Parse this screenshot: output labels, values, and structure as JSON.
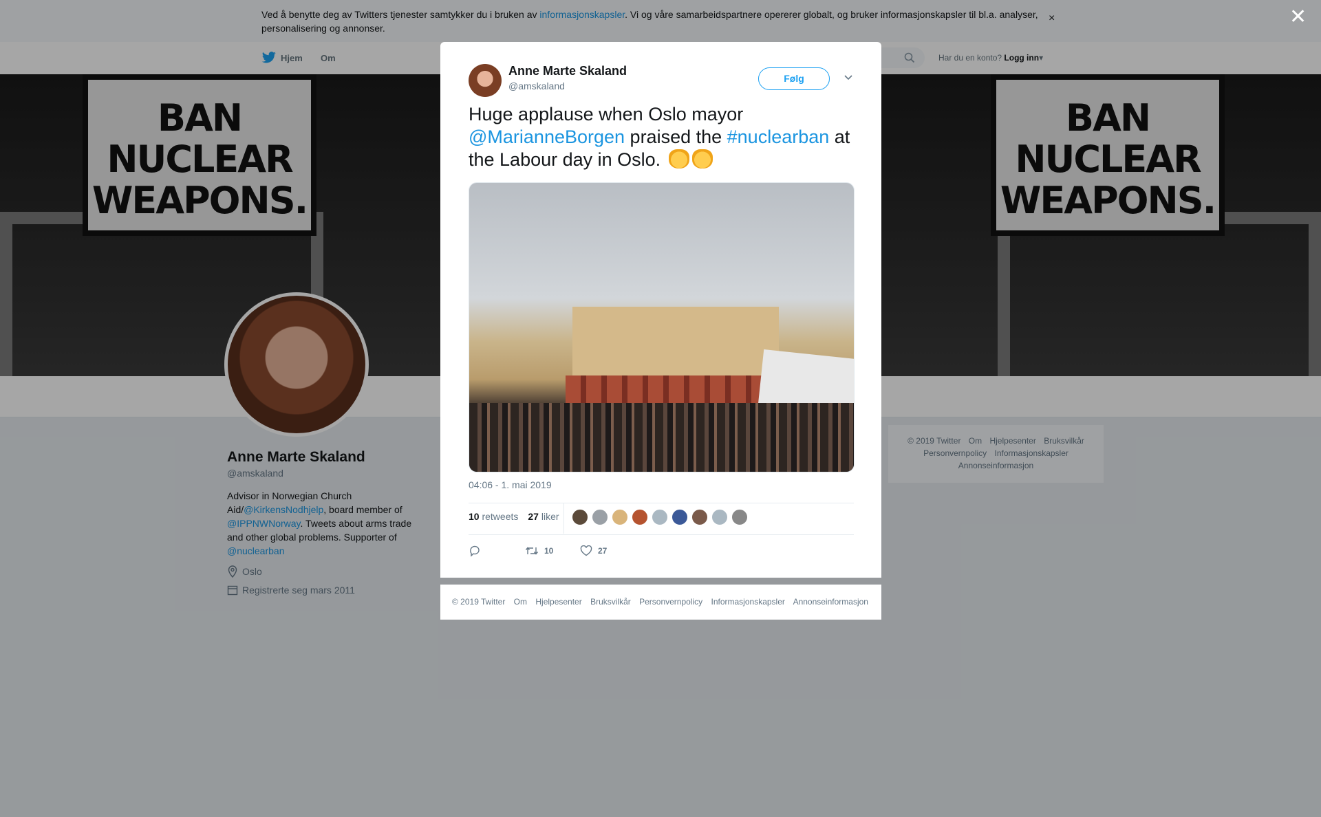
{
  "cookie": {
    "text_before": "Ved å benytte deg av Twitters tjenester samtykker du i bruken av ",
    "link": "informasjonskapsler",
    "text_after": ". Vi og våre samarbeidspartnere opererer globalt, og bruker informasjonskapsler til bl.a. analyser, personalisering og annonser.",
    "close": "×"
  },
  "nav": {
    "home": "Hjem",
    "about": "Om",
    "login_prompt": "Har du en konto?",
    "login": "Logg inn"
  },
  "banner": {
    "sign_line1": "BAN",
    "sign_line2": "NUCLEAR",
    "sign_line3": "WEAPONS."
  },
  "profile": {
    "name": "Anne Marte Skaland",
    "handle": "@amskaland",
    "bio_1": "Advisor in Norwegian Church Aid/",
    "bio_link1": "@KirkensNodhjelp",
    "bio_2": ", board member of ",
    "bio_link2": "@IPPNWNorway",
    "bio_3": ". Tweets about arms trade and other global problems. Supporter of ",
    "bio_link3": "@nuclearban",
    "location": "Oslo",
    "joined": "Registrerte seg mars 2011"
  },
  "side_footer": [
    "© 2019 Twitter",
    "Om",
    "Hjelpesenter",
    "Bruksvilkår",
    "Personvernpolicy",
    "Informasjonskapsler",
    "Annonseinformasjon"
  ],
  "overlay": {
    "close": "✕"
  },
  "tweet": {
    "name": "Anne Marte Skaland",
    "handle": "@amskaland",
    "follow": "Følg",
    "text_1": "Huge applause when Oslo mayor ",
    "mention": "@MarianneBorgen",
    "text_2": " praised the ",
    "hashtag": "#nuclearban",
    "text_3": " at the Labour day in Oslo. ",
    "time": "04:06 - 1. mai 2019",
    "retweets_count": "10",
    "retweets_label": "retweets",
    "likes_count": "27",
    "likes_label": "liker",
    "action_retweets": "10",
    "action_likes": "27",
    "liker_colors": [
      "#5b4a3a",
      "#9aa0a6",
      "#d9b47a",
      "#b5532f",
      "#aab8c2",
      "#3b5998",
      "#7a5a4a",
      "#aab8c2",
      "#888888"
    ]
  },
  "modal_footer": [
    "© 2019 Twitter",
    "Om",
    "Hjelpesenter",
    "Bruksvilkår",
    "Personvernpolicy",
    "Informasjonskapsler",
    "Annonseinformasjon"
  ]
}
